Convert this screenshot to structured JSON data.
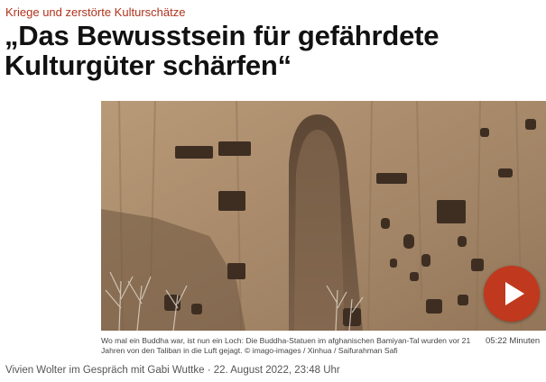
{
  "article": {
    "kicker": "Kriege und zerstörte Kulturschätze",
    "headline": "„Das Bewusstsein für gefährdete Kulturgüter schärfen“",
    "caption": "Wo mal ein Buddha war, ist nun ein Loch: Die Buddha-Statuen im afghanischen Bamiyan-Tal wurden vor 21 Jahren von den Taliban in die Luft gejagt. © imago-images / Xinhua / Saifurahman Safi",
    "duration": "05:22 Minuten",
    "byline": "Vivien Wolter im Gespräch mit Gabi Wuttke · 22. August 2022, 23:48 Uhr"
  },
  "media": {
    "image_icon": "cliff-photo",
    "play_icon": "play-icon",
    "accent_color": "#c0381d",
    "kicker_color": "#b0331c"
  }
}
